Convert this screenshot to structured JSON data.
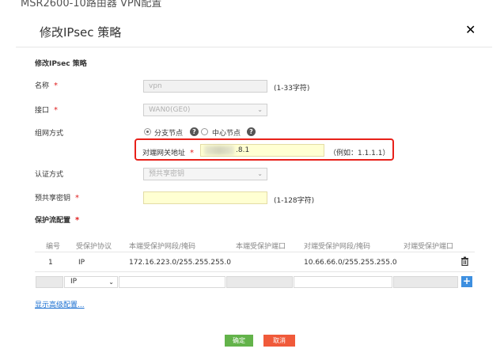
{
  "page_top_cut": "MSR2600-10路由器 VPN配置",
  "dialog": {
    "title": "修改IPsec 策略",
    "close_glyph": "✕"
  },
  "section_title": "修改IPsec 策略",
  "fields": {
    "name": {
      "label": "名称",
      "required": "*",
      "value": "vpn",
      "hint": "(1-33字符)"
    },
    "interface": {
      "label": "接口",
      "required": "*",
      "value": "WAN0(GE0)"
    },
    "network_mode": {
      "label": "组网方式",
      "options": [
        "分支节点",
        "中心节点"
      ],
      "selected": "分支节点"
    },
    "peer_gateway": {
      "label": "对端网关地址",
      "required": "*",
      "value": ".8.1",
      "hint": "（例如：1.1.1.1）"
    },
    "auth_mode": {
      "label": "认证方式",
      "value": "预共享密钥"
    },
    "psk": {
      "label": "预共享密钥",
      "required": "*",
      "value": "",
      "hint": "(1-128字符)"
    }
  },
  "flow_config": {
    "label": "保护流配置",
    "required": "*"
  },
  "table": {
    "headers": [
      "编号",
      "受保护协议",
      "本端受保护网段/掩码",
      "本端受保护端口",
      "对端受保护网段/掩码",
      "对端受保护端口"
    ],
    "rows": [
      {
        "id": "1",
        "protocol": "IP",
        "local_net": "172.16.223.0/255.255.255.0",
        "local_port": "",
        "remote_net": "10.66.66.0/255.255.255.0",
        "remote_port": ""
      }
    ],
    "new_row_protocol": "IP"
  },
  "advanced_link": "显示高级配置...",
  "buttons": {
    "ok": "确定",
    "cancel": "取消"
  },
  "colors": {
    "required": "#e02020",
    "highlight_box": "#e8211a",
    "ok": "#63b34a",
    "cancel": "#f05a3a",
    "link": "#1a6fd1",
    "add": "#3d8fe0"
  }
}
